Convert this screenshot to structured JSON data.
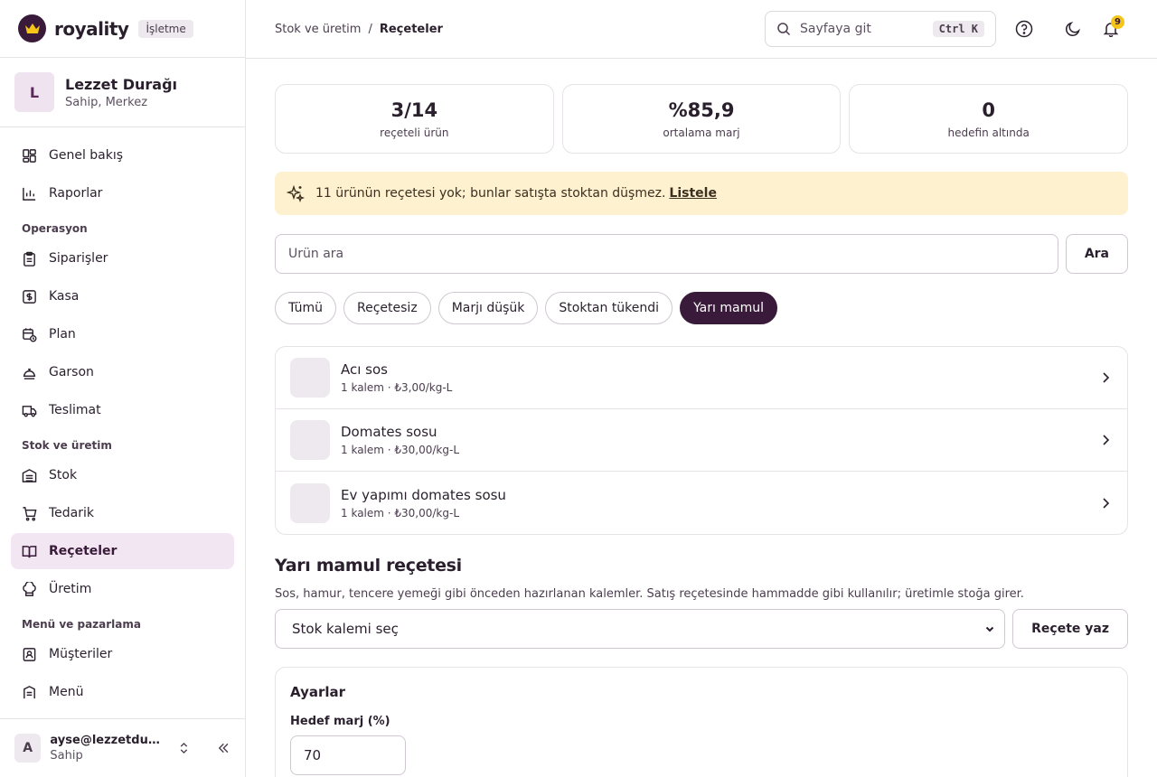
{
  "brand": {
    "name": "royality",
    "badge": "İşletme"
  },
  "org": {
    "initial": "L",
    "name": "Lezzet Durağı",
    "role": "Sahip, Merkez"
  },
  "nav": {
    "top": [
      {
        "label": "Genel bakış",
        "icon": "dashboard-icon"
      },
      {
        "label": "Raporlar",
        "icon": "chart-icon"
      }
    ],
    "section_operasyon": "Operasyon",
    "operasyon": [
      {
        "label": "Siparişler",
        "icon": "clipboard-icon"
      },
      {
        "label": "Kasa",
        "icon": "cash-icon"
      },
      {
        "label": "Plan",
        "icon": "calendar-clock-icon"
      },
      {
        "label": "Garson",
        "icon": "dish-icon"
      },
      {
        "label": "Teslimat",
        "icon": "truck-icon"
      }
    ],
    "section_stok": "Stok ve üretim",
    "stok": [
      {
        "label": "Stok",
        "icon": "warehouse-icon"
      },
      {
        "label": "Tedarik",
        "icon": "cart-icon"
      },
      {
        "label": "Reçeteler",
        "icon": "book-icon"
      },
      {
        "label": "Üretim",
        "icon": "chef-hat-icon"
      }
    ],
    "section_menu": "Menü ve pazarlama",
    "menu": [
      {
        "label": "Müşteriler",
        "icon": "contact-icon"
      },
      {
        "label": "Menü",
        "icon": "menu-book-icon"
      }
    ]
  },
  "user": {
    "initial": "A",
    "email": "ayse@lezzetdurağı.com",
    "role": "Sahip"
  },
  "topbar": {
    "breadcrumb_parent": "Stok ve üretim",
    "breadcrumb_sep": "/",
    "breadcrumb_current": "Reçeteler",
    "search_placeholder": "Sayfaya git",
    "search_kbd": "Ctrl K",
    "notification_count": "9"
  },
  "stats": [
    {
      "value": "3/14",
      "label": "reçeteli ürün"
    },
    {
      "value": "%85,9",
      "label": "ortalama marj"
    },
    {
      "value": "0",
      "label": "hedefin altında"
    }
  ],
  "alert": {
    "text": "11 ürünün reçetesi yok; bunlar satışta stoktan düşmez.",
    "link": "Listele"
  },
  "search": {
    "placeholder": "Ürün ara",
    "button": "Ara"
  },
  "filters": [
    {
      "label": "Tümü",
      "active": false
    },
    {
      "label": "Reçetesiz",
      "active": false
    },
    {
      "label": "Marjı düşük",
      "active": false
    },
    {
      "label": "Stoktan tükendi",
      "active": false
    },
    {
      "label": "Yarı mamul",
      "active": true
    }
  ],
  "items": [
    {
      "name": "Acı sos",
      "meta": "1 kalem · ₺3,00/kg-L"
    },
    {
      "name": "Domates sosu",
      "meta": "1 kalem · ₺30,00/kg-L"
    },
    {
      "name": "Ev yapımı domates sosu",
      "meta": "1 kalem · ₺30,00/kg-L"
    }
  ],
  "semi": {
    "title": "Yarı mamul reçetesi",
    "description": "Sos, hamur, tencere yemeği gibi önceden hazırlanan kalemler. Satış reçetesinde hammadde gibi kullanılır; üretimle stoğa girer.",
    "select_value": "Stok kalemi seç",
    "button": "Reçete yaz"
  },
  "settings": {
    "title": "Ayarlar",
    "target_label": "Hedef marj (%)",
    "target_value": "70"
  },
  "colors": {
    "accent": "#3a1a3a",
    "active_nav_bg": "#f1e6f1",
    "alert_bg": "#fdf1cf",
    "badge": "#f5c518"
  }
}
